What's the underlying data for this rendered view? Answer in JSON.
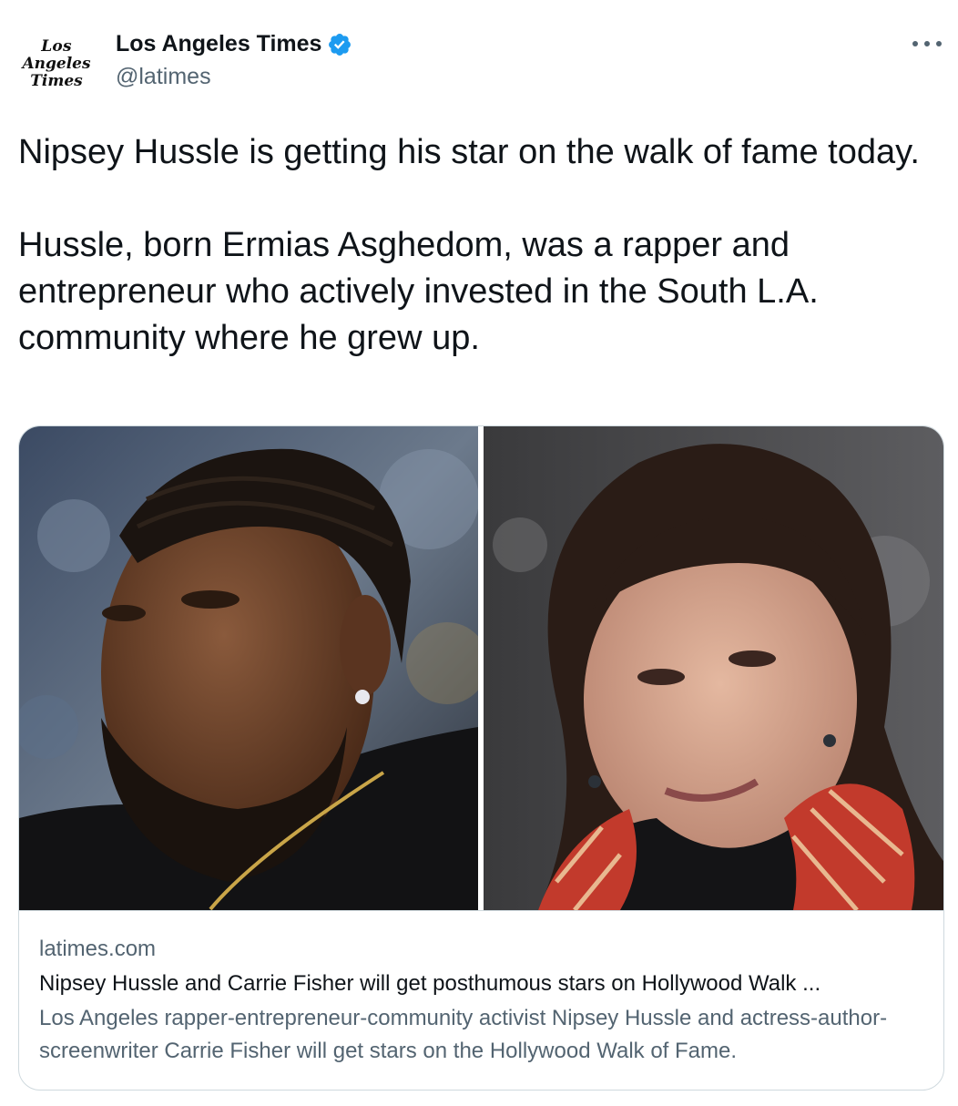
{
  "author": {
    "logo_lines": [
      "Los",
      "Angeles",
      "Times"
    ],
    "display_name": "Los Angeles Times",
    "verified": true,
    "handle": "@latimes"
  },
  "icons": {
    "verified": "verified-badge-icon",
    "more": "more-options-icon"
  },
  "tweet": {
    "paragraph_1": "Nipsey Hussle is getting his star on the walk of fame today.",
    "paragraph_2": "Hussle, born Ermias Asghedom, was a rapper and entrepreneur who actively invested in the South L.A. community where he grew up."
  },
  "card": {
    "domain": "latimes.com",
    "title": "Nipsey Hussle and Carrie Fisher will get posthumous stars on Hollywood Walk ...",
    "description": "Los Angeles rapper-entrepreneur-community activist Nipsey Hussle and actress-author-screenwriter Carrie Fisher will get stars on the Hollywood Walk of Fame."
  },
  "colors": {
    "text_primary": "#0f1419",
    "text_secondary": "#536471",
    "verified_blue": "#1d9bf0",
    "border": "#cfd9de"
  }
}
